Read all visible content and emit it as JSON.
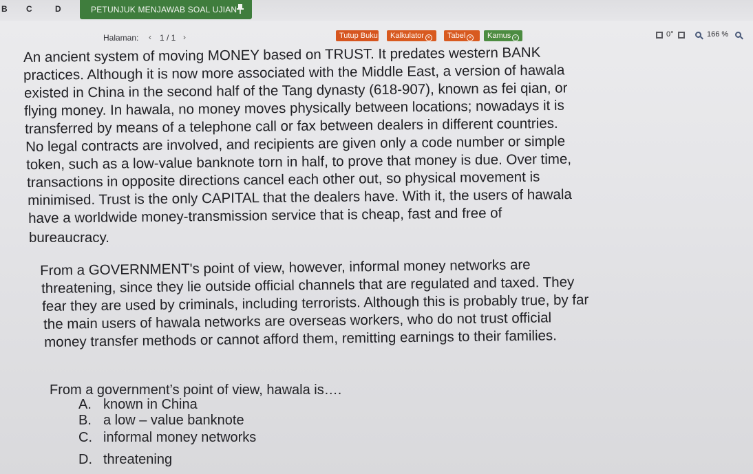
{
  "nav": {
    "letters": [
      "B",
      "C",
      "D"
    ]
  },
  "header": {
    "title": "PETUNJUK MENJAWAB SOAL UJIAN"
  },
  "toolbar": {
    "page_label": "Halaman:",
    "page_prev": "‹",
    "page_count": "1 / 1",
    "page_next": "›",
    "buttons": {
      "tutup": "Tutup Buku",
      "kalkulator": "Kalkulator",
      "tabel": "Tabel",
      "kamus": "Kamus"
    },
    "rotate_label": "0°",
    "zoom": "166 %"
  },
  "passage": {
    "p1": [
      "An ancient system of moving MONEY based on TRUST. It predates western BANK",
      "practices. Although it is now more associated with the Middle East, a version of hawala",
      "existed in China in the second half of the Tang dynasty (618-907), known as fei qian, or",
      "flying money. In hawala, no money moves physically between locations; nowadays it is",
      "transferred by means of a telephone call or fax between dealers in different countries.",
      "No legal contracts are involved, and recipients are given only a code number or simple",
      "token, such as a low-value banknote torn in half, to prove that money is due. Over time,",
      "transactions in opposite directions cancel each other out, so physical movement is",
      "minimised. Trust is the only CAPITAL that the dealers have. With it, the users of hawala",
      "have a worldwide money-transmission service that is cheap, fast and free of",
      "bureaucracy."
    ],
    "p2": [
      "From a GOVERNMENT's point of view, however, informal money networks are",
      "threatening, since they lie outside official channels that are regulated and taxed. They",
      "fear they are used by criminals, including terrorists. Although this is probably true, by far",
      "the main users of hawala networks are overseas workers, who do not trust official",
      "money transfer methods or cannot afford them, remitting earnings to their families."
    ]
  },
  "question": {
    "text": "From a government’s point of view, hawala is….",
    "options": [
      {
        "letter": "A.",
        "text": "known in China"
      },
      {
        "letter": "B.",
        "text": "a low – value banknote"
      },
      {
        "letter": "C.",
        "text": "informal money networks"
      },
      {
        "letter": "D.",
        "text": "threatening"
      }
    ]
  }
}
